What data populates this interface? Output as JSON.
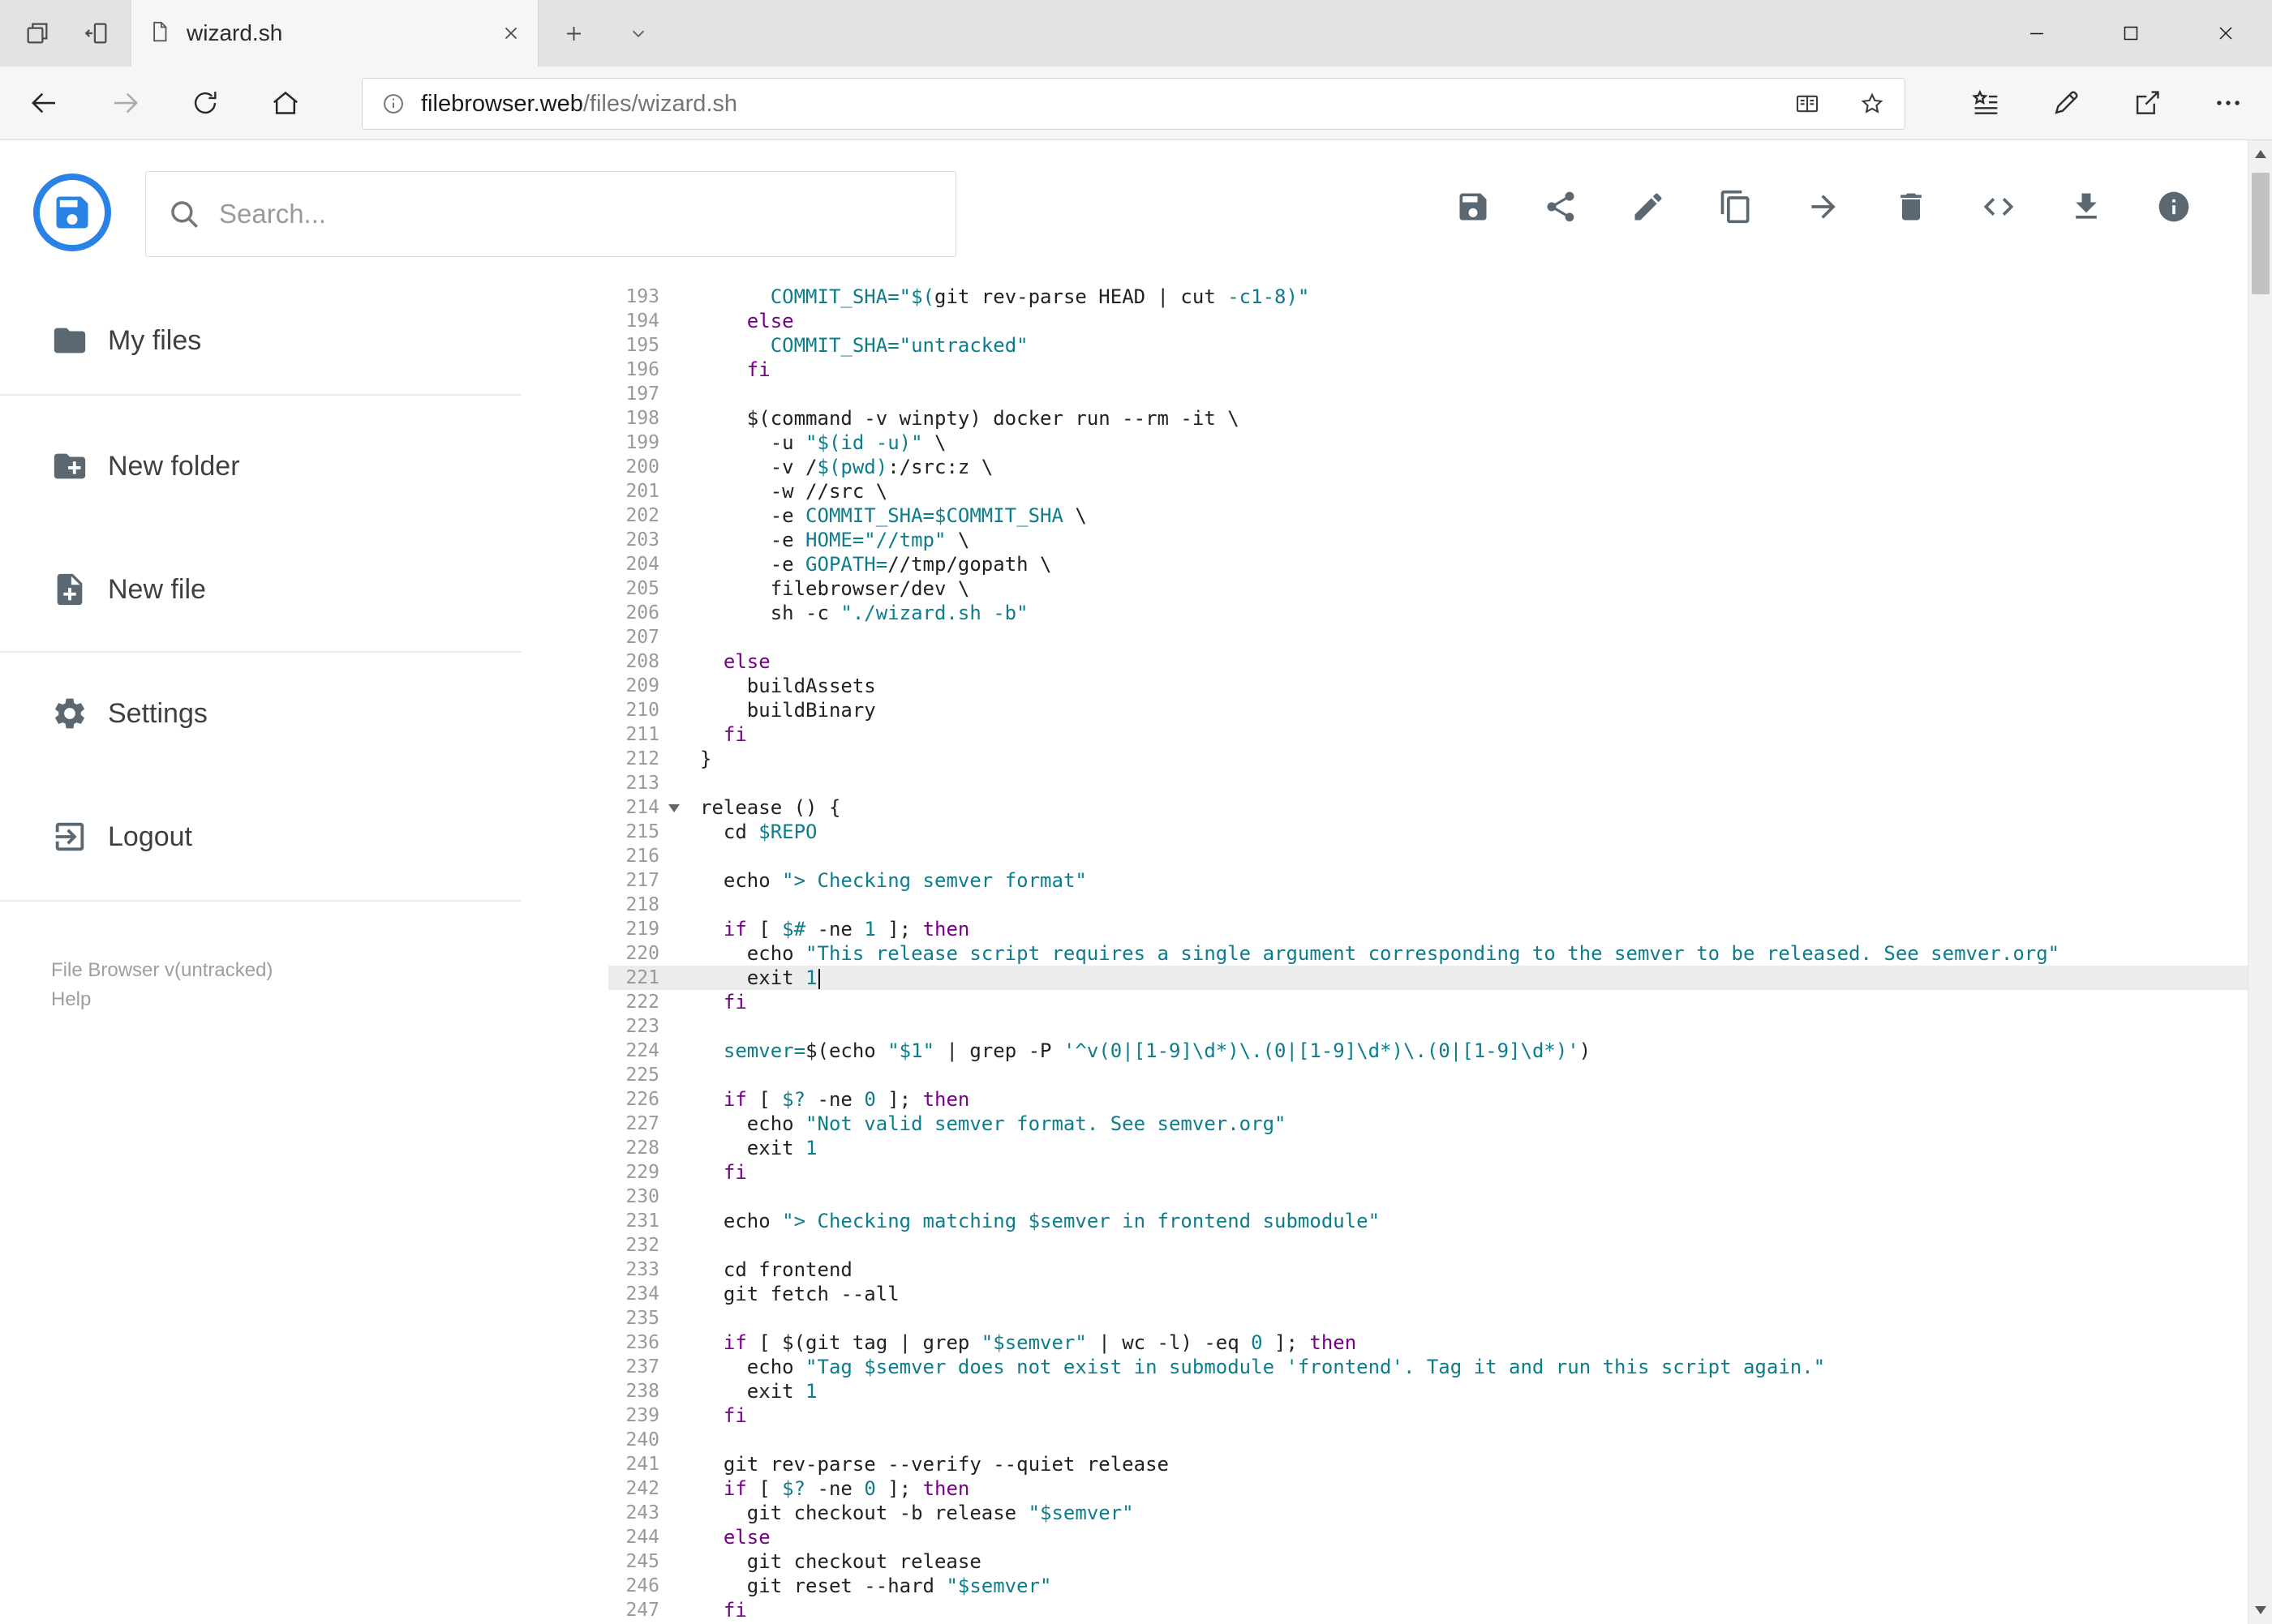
{
  "browser": {
    "tab_title": "wizard.sh",
    "url_host": "filebrowser.web",
    "url_path": "/files/wizard.sh"
  },
  "header": {
    "search_placeholder": "Search...",
    "toolbar_icons": [
      "save-icon",
      "share-icon",
      "edit-icon",
      "copy-icon",
      "move-icon",
      "delete-icon",
      "code-icon",
      "download-icon",
      "info-icon"
    ]
  },
  "sidebar": {
    "items": [
      {
        "label": "My files",
        "icon": "folder-icon"
      },
      {
        "label": "New folder",
        "icon": "new-folder-icon"
      },
      {
        "label": "New file",
        "icon": "new-file-icon"
      },
      {
        "label": "Settings",
        "icon": "settings-icon"
      },
      {
        "label": "Logout",
        "icon": "logout-icon"
      }
    ],
    "version": "File Browser v(untracked)",
    "help": "Help"
  },
  "editor": {
    "active_line": 221,
    "colors": {
      "keyword": "#770088",
      "string_def": "#0d7d8c",
      "plain": "#212121",
      "line_number": "#999999",
      "active_line_bg": "#ececec",
      "accent_blue": "#2a82e4",
      "icon_gray": "#5b6872"
    },
    "lines": [
      {
        "n": 193,
        "seg": [
          [
            "p",
            "      "
          ],
          [
            "s",
            "COMMIT_SHA=\"$("
          ],
          [
            "p",
            "git rev-parse HEAD | cut "
          ],
          [
            "s",
            "-c1-8)\""
          ]
        ]
      },
      {
        "n": 194,
        "seg": [
          [
            "p",
            "    "
          ],
          [
            "k",
            "else"
          ]
        ]
      },
      {
        "n": 195,
        "seg": [
          [
            "p",
            "      "
          ],
          [
            "s",
            "COMMIT_SHA=\"untracked\""
          ]
        ]
      },
      {
        "n": 196,
        "seg": [
          [
            "p",
            "    "
          ],
          [
            "k",
            "fi"
          ]
        ]
      },
      {
        "n": 197,
        "seg": []
      },
      {
        "n": 198,
        "seg": [
          [
            "p",
            "    $(command -v winpty) docker run --rm -it \\"
          ]
        ]
      },
      {
        "n": 199,
        "seg": [
          [
            "p",
            "      -u "
          ],
          [
            "s",
            "\"$(id -u)\""
          ],
          [
            "p",
            " \\"
          ]
        ]
      },
      {
        "n": 200,
        "seg": [
          [
            "p",
            "      -v /"
          ],
          [
            "s",
            "$(pwd)"
          ],
          [
            "p",
            ":/src:z \\"
          ]
        ]
      },
      {
        "n": 201,
        "seg": [
          [
            "p",
            "      -w //src \\"
          ]
        ]
      },
      {
        "n": 202,
        "seg": [
          [
            "p",
            "      -e "
          ],
          [
            "s",
            "COMMIT_SHA=$COMMIT_SHA"
          ],
          [
            "p",
            " \\"
          ]
        ]
      },
      {
        "n": 203,
        "seg": [
          [
            "p",
            "      -e "
          ],
          [
            "s",
            "HOME=\"//tmp\""
          ],
          [
            "p",
            " \\"
          ]
        ]
      },
      {
        "n": 204,
        "seg": [
          [
            "p",
            "      -e "
          ],
          [
            "s",
            "GOPATH="
          ],
          [
            "p",
            "//tmp/gopath \\"
          ]
        ]
      },
      {
        "n": 205,
        "seg": [
          [
            "p",
            "      filebrowser/dev \\"
          ]
        ]
      },
      {
        "n": 206,
        "seg": [
          [
            "p",
            "      sh -c "
          ],
          [
            "s",
            "\"./wizard.sh -b\""
          ]
        ]
      },
      {
        "n": 207,
        "seg": []
      },
      {
        "n": 208,
        "seg": [
          [
            "p",
            "  "
          ],
          [
            "k",
            "else"
          ]
        ]
      },
      {
        "n": 209,
        "seg": [
          [
            "p",
            "    buildAssets"
          ]
        ]
      },
      {
        "n": 210,
        "seg": [
          [
            "p",
            "    buildBinary"
          ]
        ]
      },
      {
        "n": 211,
        "seg": [
          [
            "p",
            "  "
          ],
          [
            "k",
            "fi"
          ]
        ]
      },
      {
        "n": 212,
        "seg": [
          [
            "p",
            "}"
          ]
        ]
      },
      {
        "n": 213,
        "seg": []
      },
      {
        "n": 214,
        "fold": true,
        "seg": [
          [
            "p",
            "release () {"
          ]
        ]
      },
      {
        "n": 215,
        "seg": [
          [
            "p",
            "  cd "
          ],
          [
            "s",
            "$REPO"
          ]
        ]
      },
      {
        "n": 216,
        "seg": []
      },
      {
        "n": 217,
        "seg": [
          [
            "p",
            "  echo "
          ],
          [
            "s",
            "\"> Checking semver format\""
          ]
        ]
      },
      {
        "n": 218,
        "seg": []
      },
      {
        "n": 219,
        "seg": [
          [
            "p",
            "  "
          ],
          [
            "k",
            "if"
          ],
          [
            "p",
            " [ "
          ],
          [
            "s",
            "$#"
          ],
          [
            "p",
            " -ne "
          ],
          [
            "s",
            "1"
          ],
          [
            "p",
            " ]; "
          ],
          [
            "k",
            "then"
          ]
        ]
      },
      {
        "n": 220,
        "seg": [
          [
            "p",
            "    echo "
          ],
          [
            "s",
            "\"This release script requires a single argument corresponding to the semver to be released. See semver.org\""
          ]
        ]
      },
      {
        "n": 221,
        "caret": true,
        "seg": [
          [
            "p",
            "    exit "
          ],
          [
            "s",
            "1"
          ]
        ]
      },
      {
        "n": 222,
        "seg": [
          [
            "p",
            "  "
          ],
          [
            "k",
            "fi"
          ]
        ]
      },
      {
        "n": 223,
        "seg": []
      },
      {
        "n": 224,
        "seg": [
          [
            "p",
            "  "
          ],
          [
            "s",
            "semver="
          ],
          [
            "p",
            "$(echo "
          ],
          [
            "s",
            "\"$1\""
          ],
          [
            "p",
            " | grep -P "
          ],
          [
            "s",
            "'^v(0|[1-9]\\d*)\\.(0|[1-9]\\d*)\\.(0|[1-9]\\d*)'"
          ],
          [
            "p",
            ")"
          ]
        ]
      },
      {
        "n": 225,
        "seg": []
      },
      {
        "n": 226,
        "seg": [
          [
            "p",
            "  "
          ],
          [
            "k",
            "if"
          ],
          [
            "p",
            " [ "
          ],
          [
            "s",
            "$?"
          ],
          [
            "p",
            " -ne "
          ],
          [
            "s",
            "0"
          ],
          [
            "p",
            " ]; "
          ],
          [
            "k",
            "then"
          ]
        ]
      },
      {
        "n": 227,
        "seg": [
          [
            "p",
            "    echo "
          ],
          [
            "s",
            "\"Not valid semver format. See semver.org\""
          ]
        ]
      },
      {
        "n": 228,
        "seg": [
          [
            "p",
            "    exit "
          ],
          [
            "s",
            "1"
          ]
        ]
      },
      {
        "n": 229,
        "seg": [
          [
            "p",
            "  "
          ],
          [
            "k",
            "fi"
          ]
        ]
      },
      {
        "n": 230,
        "seg": []
      },
      {
        "n": 231,
        "seg": [
          [
            "p",
            "  echo "
          ],
          [
            "s",
            "\"> Checking matching $semver in frontend submodule\""
          ]
        ]
      },
      {
        "n": 232,
        "seg": []
      },
      {
        "n": 233,
        "seg": [
          [
            "p",
            "  cd frontend"
          ]
        ]
      },
      {
        "n": 234,
        "seg": [
          [
            "p",
            "  git fetch --all"
          ]
        ]
      },
      {
        "n": 235,
        "seg": []
      },
      {
        "n": 236,
        "seg": [
          [
            "p",
            "  "
          ],
          [
            "k",
            "if"
          ],
          [
            "p",
            " [ $(git tag | grep "
          ],
          [
            "s",
            "\"$semver\""
          ],
          [
            "p",
            " | wc -l) -eq "
          ],
          [
            "s",
            "0"
          ],
          [
            "p",
            " ]; "
          ],
          [
            "k",
            "then"
          ]
        ]
      },
      {
        "n": 237,
        "seg": [
          [
            "p",
            "    echo "
          ],
          [
            "s",
            "\"Tag $semver does not exist in submodule 'frontend'. Tag it and run this script again.\""
          ]
        ]
      },
      {
        "n": 238,
        "seg": [
          [
            "p",
            "    exit "
          ],
          [
            "s",
            "1"
          ]
        ]
      },
      {
        "n": 239,
        "seg": [
          [
            "p",
            "  "
          ],
          [
            "k",
            "fi"
          ]
        ]
      },
      {
        "n": 240,
        "seg": []
      },
      {
        "n": 241,
        "seg": [
          [
            "p",
            "  git rev-parse --verify --quiet release"
          ]
        ]
      },
      {
        "n": 242,
        "seg": [
          [
            "p",
            "  "
          ],
          [
            "k",
            "if"
          ],
          [
            "p",
            " [ "
          ],
          [
            "s",
            "$?"
          ],
          [
            "p",
            " -ne "
          ],
          [
            "s",
            "0"
          ],
          [
            "p",
            " ]; "
          ],
          [
            "k",
            "then"
          ]
        ]
      },
      {
        "n": 243,
        "seg": [
          [
            "p",
            "    git checkout -b release "
          ],
          [
            "s",
            "\"$semver\""
          ]
        ]
      },
      {
        "n": 244,
        "seg": [
          [
            "p",
            "  "
          ],
          [
            "k",
            "else"
          ]
        ]
      },
      {
        "n": 245,
        "seg": [
          [
            "p",
            "    git checkout release"
          ]
        ]
      },
      {
        "n": 246,
        "seg": [
          [
            "p",
            "    git reset --hard "
          ],
          [
            "s",
            "\"$semver\""
          ]
        ]
      },
      {
        "n": 247,
        "seg": [
          [
            "p",
            "  "
          ],
          [
            "k",
            "fi"
          ]
        ]
      }
    ]
  }
}
